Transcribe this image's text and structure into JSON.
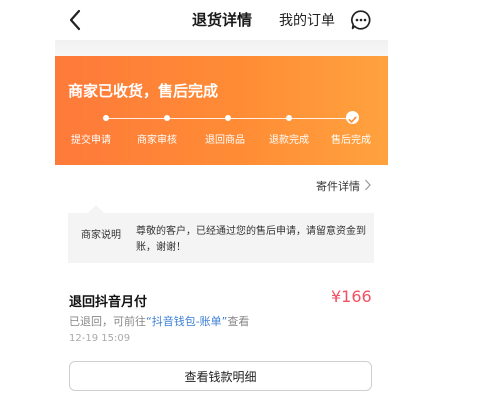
{
  "header": {
    "title": "退货详情",
    "my_orders": "我的订单",
    "icons": {
      "back": "chevron-left-icon",
      "more": "more-options-icon"
    }
  },
  "status": {
    "title": "商家已收货，售后完成",
    "steps": [
      {
        "label": "提交申请"
      },
      {
        "label": "商家审核"
      },
      {
        "label": "退回商品"
      },
      {
        "label": "退款完成"
      },
      {
        "label": "售后完成"
      }
    ],
    "banner_color_start": "#fe7a3a",
    "banner_color_end": "#ffa23e"
  },
  "shipping": {
    "link_label": "寄件详情"
  },
  "merchant_note": {
    "label": "商家说明",
    "text": "尊敬的客户，已经通过您的售后申请，请留意资金到账，谢谢！"
  },
  "refund": {
    "title": "退回抖音月付",
    "amount": "¥166",
    "desc_prefix": "已退回，可前往",
    "desc_link": "“抖音钱包-账单”",
    "desc_suffix": "查看",
    "time": "12-19 15:09",
    "detail_button": "查看钱款明细",
    "amount_color": "#f35063",
    "link_color": "#3d7fd6"
  }
}
